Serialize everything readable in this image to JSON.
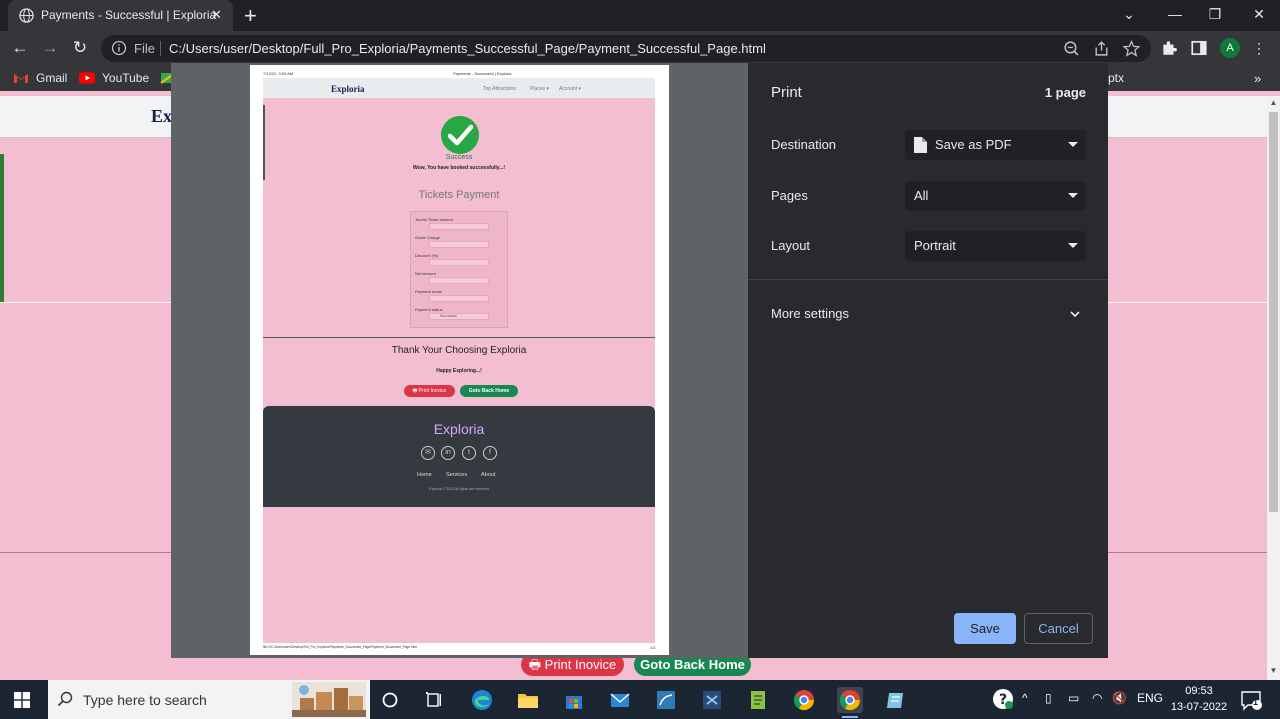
{
  "browser": {
    "tab_title": "Payments - Successful | Exploria",
    "address_scheme": "File",
    "address_url": "C:/Users/user/Desktop/Full_Pro_Exploria/Payments_Successful_Page/Payment_Successful_Page.html",
    "avatar_letter": "A",
    "bookmarks": [
      "Gmail",
      "YouTube"
    ],
    "bookmark_partial": "ptx"
  },
  "page": {
    "brand": "Ex",
    "print_button": "Print Inovice",
    "home_button": "Goto Back Home"
  },
  "preview": {
    "header_date": "7/13/22, 9:53 AM",
    "header_title": "Payments - Successful | Exploria",
    "brand": "Exploria",
    "nav": [
      "Top Attractions",
      "Places ▾",
      "Account ▾"
    ],
    "success": "Success",
    "booked": "Wow, You have booked successfully...!",
    "tickets_title": "Tickets Payment",
    "fields": [
      {
        "label": "Tourist Ticket amount",
        "value": ""
      },
      {
        "label": "Guide Charge",
        "value": ""
      },
      {
        "label": "Discount (%)",
        "value": ""
      },
      {
        "label": "Net amount",
        "value": ""
      },
      {
        "label": "Payment mode",
        "value": ""
      },
      {
        "label": "Payment status",
        "value": "Successful"
      }
    ],
    "thanks": "Thank Your Choosing Exploria",
    "happy": "Happy Exploring...!",
    "print_button": "Print Inovice",
    "home_button": "Goto Back Home",
    "footer_title": "Exploria",
    "footer_links": [
      "Home",
      "Services",
      "About"
    ],
    "copyright": "Exploria © 2022 All rights are reserved",
    "footer_path": "file:///C:/Users/user/Desktop/Full_Pro_Exploria/Payments_Successful_Page/Payment_Successful_Page.html",
    "footer_pagenum": "1/1"
  },
  "print_dialog": {
    "title": "Print",
    "page_count": "1 page",
    "destination_label": "Destination",
    "destination_value": "Save as PDF",
    "pages_label": "Pages",
    "pages_value": "All",
    "layout_label": "Layout",
    "layout_value": "Portrait",
    "more_settings": "More settings",
    "save": "Save",
    "cancel": "Cancel"
  },
  "taskbar": {
    "search_placeholder": "Type here to search",
    "language": "ENG",
    "time": "09:53",
    "date": "13-07-2022",
    "notification_count": "1"
  },
  "colors": {
    "page_bg": "#f3bed2",
    "accent_blue": "#8ab4f8",
    "success_green": "#28a745",
    "danger_red": "#dc3545"
  }
}
